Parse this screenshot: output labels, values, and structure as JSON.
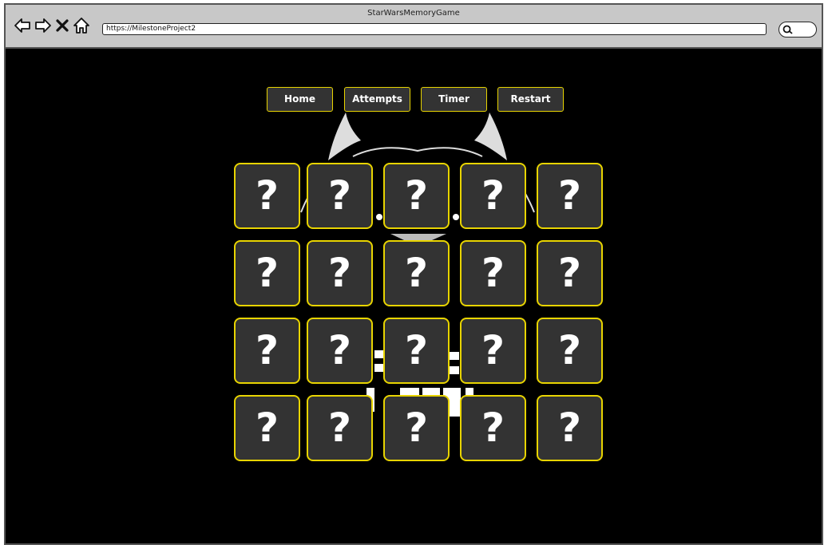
{
  "browser": {
    "title": "StarWarsMemoryGame",
    "url": "https://MilestoneProject2",
    "nav_icons": [
      "back-arrow-icon",
      "forward-arrow-icon",
      "close-x-icon",
      "home-icon"
    ],
    "search_icon": "search-icon"
  },
  "menu": {
    "home": "Home",
    "attempts": "Attempts",
    "timer": "Timer",
    "restart": "Restart"
  },
  "cards": {
    "symbol": "?",
    "rows": 4,
    "columns": 5
  },
  "colors": {
    "background": "#000000",
    "card_fill": "#333333",
    "card_border": "#e8d400",
    "text": "#ffffff",
    "chrome": "#c8c8c8"
  }
}
